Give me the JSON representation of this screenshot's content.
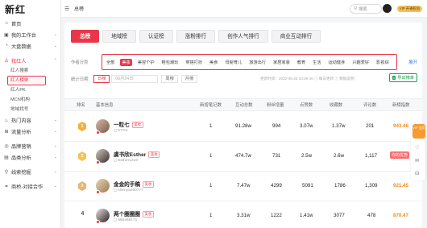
{
  "app": {
    "logo": "新红",
    "breadcrumb": "总榜"
  },
  "topbar": {
    "search_placeholder": "搜索",
    "vip_label": "VIP 开通权益"
  },
  "sidebar": {
    "items": [
      {
        "label": "首页",
        "icon": "home-icon",
        "icon_glyph": "⌂"
      },
      {
        "label": "我的工作台",
        "icon": "workbench-icon",
        "icon_glyph": "▣",
        "chevron": "⌄"
      },
      {
        "label": "大盘数据",
        "icon": "chart-icon",
        "icon_glyph": "◔",
        "chevron": "⌄"
      },
      {
        "label": "找红人",
        "icon": "user-icon",
        "icon_glyph": "♙",
        "chevron": "⌃",
        "active": true
      },
      {
        "label": "热门内容",
        "icon": "fire-icon",
        "icon_glyph": "♨",
        "chevron": "⌄"
      },
      {
        "label": "流量分析",
        "icon": "flow-icon",
        "icon_glyph": "⊞",
        "chevron": "⌄"
      },
      {
        "label": "品牌营销",
        "icon": "brand-icon",
        "icon_glyph": "◎",
        "chevron": "⌄"
      },
      {
        "label": "品类分析",
        "icon": "category-icon",
        "icon_glyph": "▤",
        "chevron": "⌄"
      },
      {
        "label": "线索挖掘",
        "icon": "lead-icon",
        "icon_glyph": "⚲",
        "chevron": "⌄"
      },
      {
        "label": "商桥-对接合作",
        "icon": "bridge-icon",
        "icon_glyph": "⚭",
        "chevron": "⌄"
      }
    ],
    "sub_items": [
      "红人搜索",
      "红人榜单",
      "红人PK",
      "MCN机构",
      "地域找号"
    ],
    "selected_sub": "红人榜单"
  },
  "tabs": [
    "总榜",
    "地域榜",
    "认证榜",
    "涨粉排行",
    "创作人气排行",
    "商业互动排行"
  ],
  "active_tab": "总榜",
  "filters": {
    "label": "作者分类",
    "categories": [
      "全部",
      "美妆",
      "美容个护",
      "鞋包潮玩",
      "穿搭打扮",
      "美食",
      "母婴育儿",
      "旅游出行",
      "家居家装",
      "教育",
      "生活",
      "运动健身",
      "兴趣爱好",
      "影视综"
    ],
    "active": "美妆",
    "expand": "展开"
  },
  "period": {
    "label": "统计日期",
    "tabs": [
      "日榜",
      "周榜",
      "月榜"
    ],
    "active": "日榜",
    "date": "06月24日",
    "update_info": "更新时间：2022-06-25 10:09:46  ⓘ 每日更新  ⓘ 数据说明",
    "export": "导出榜单"
  },
  "table": {
    "headers": [
      "排名",
      "基本信息",
      "新增笔记数",
      "互动总数",
      "粉丝增量",
      "点赞数",
      "收藏数",
      "评论数",
      "新榜指数"
    ],
    "rows": [
      {
        "rank": "1",
        "name": "一粒七",
        "tag": "美妆",
        "account": "b77re",
        "notes": "1",
        "interactions": "91.28w",
        "fans": "994",
        "likes": "3.07w",
        "favorites": "1.37w",
        "comments": "201",
        "score": "943.46"
      },
      {
        "rank": "2",
        "name": "虞书欣Esther",
        "tag": "美妆",
        "account": "Esther1218",
        "notes": "1",
        "interactions": "474.7w",
        "fans": "731",
        "likes": "2.5w",
        "favorites": "2.6w",
        "comments": "1,117",
        "score": "",
        "badge": "你的优势"
      },
      {
        "rank": "3",
        "name": "金金的手稿",
        "tag": "美妆",
        "account": "shenyan00777",
        "notes": "1",
        "interactions": "7.47w",
        "fans": "4299",
        "likes": "5091",
        "favorites": "1786",
        "comments": "1,309",
        "score": "921.45"
      },
      {
        "rank": "4",
        "name": "两个圈圈圈",
        "tag": "美妆",
        "account": "565469171",
        "notes": "1",
        "interactions": "3.31w",
        "fans": "1222",
        "likes": "1.41w",
        "favorites": "3077",
        "comments": "478",
        "score": "870.47"
      }
    ]
  },
  "float": {
    "vip": "VIP 会员"
  }
}
